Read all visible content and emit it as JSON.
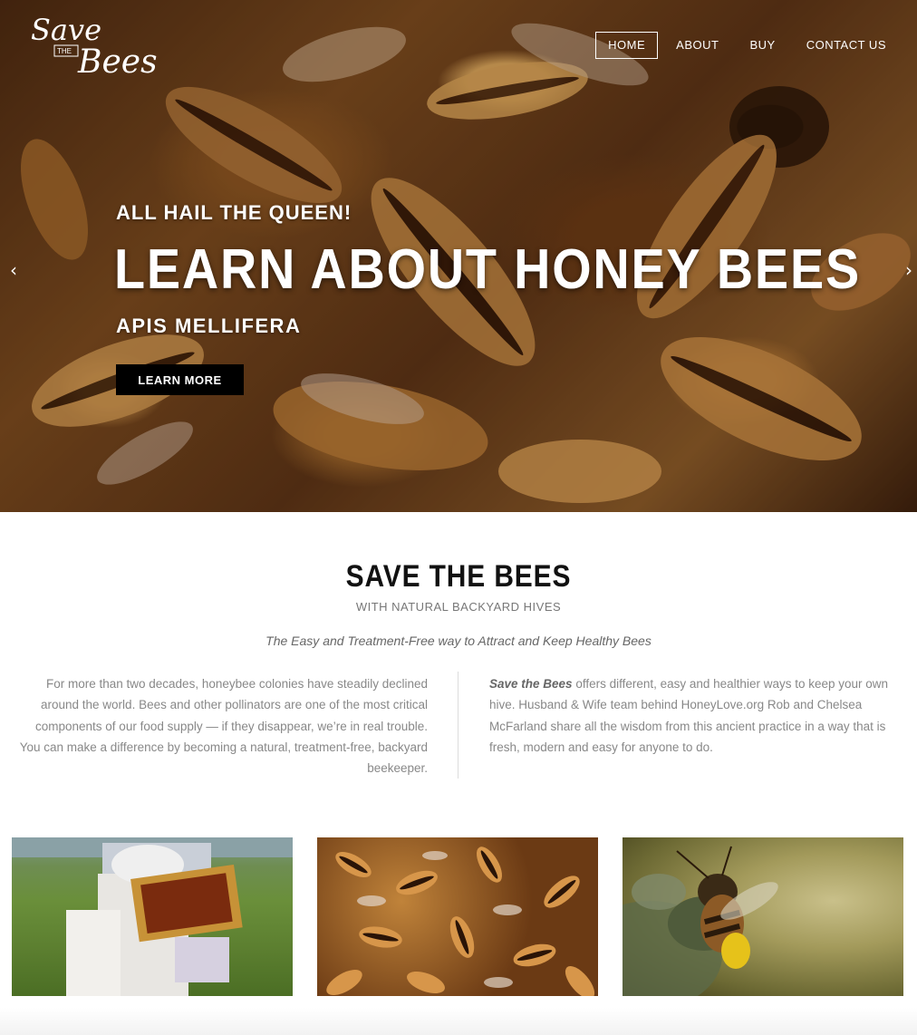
{
  "brand": {
    "logo_line1": "Save",
    "logo_the": "THE",
    "logo_line2": "Bees"
  },
  "nav": {
    "items": [
      {
        "label": "HOME",
        "active": true
      },
      {
        "label": "ABOUT",
        "active": false
      },
      {
        "label": "BUY",
        "active": false
      },
      {
        "label": "CONTACT US",
        "active": false
      }
    ]
  },
  "hero": {
    "kicker": "ALL HAIL THE QUEEN!",
    "title": "LEARN ABOUT HONEY BEES",
    "subtitle": "APIS MELLIFERA",
    "button_label": "LEARN MORE",
    "prev_icon": "chevron-left-icon",
    "next_icon": "chevron-right-icon"
  },
  "intro": {
    "title": "SAVE THE BEES",
    "subtitle": "WITH NATURAL BACKYARD HIVES",
    "tagline": "The Easy and Treatment-Free way to Attract and Keep Healthy Bees",
    "left_text": "For more than two decades, honeybee colonies have steadily declined around the world. Bees and other pollinators are one of the most critical components of our food supply — if they disappear, we’re in real trouble. You can make a difference by becoming a natural, treatment-free, backyard beekeeper.",
    "right_emphasis": "Save the Bees",
    "right_text": " offers different, easy and healthier ways to keep your own hive. Husband & Wife team behind HoneyLove.org Rob and Chelsea McFarland share all the wisdom from this ancient practice in a way that is fresh, modern and easy for anyone to do."
  },
  "colors": {
    "accent": "#000000",
    "text": "#888888",
    "heading": "#111111"
  }
}
